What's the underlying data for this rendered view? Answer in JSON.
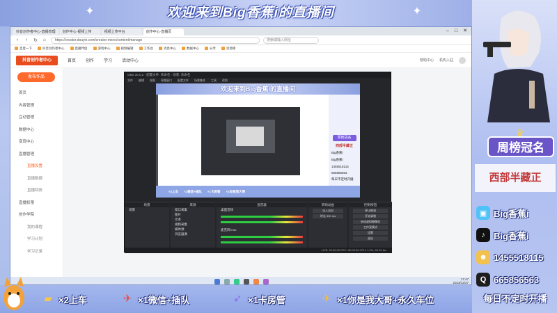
{
  "banner": {
    "title": "欢迎来到Big香蕉i的直播间"
  },
  "browser": {
    "tabs": [
      "抖音创作者中心-直播管理",
      "创作中心·视频上传",
      "视频上传平台",
      "创作中心·直播页"
    ],
    "url": "https://creator.douyin.com/creator-micro/content/manage",
    "search_placeholder": "搜索或输入网址",
    "bookmarks": [
      "百度一下",
      "抖音创作者中心",
      "直播伴侣",
      "游戏中心",
      "视频编辑",
      "工作台",
      "消息中心",
      "数据中心",
      "分享",
      "资源库"
    ]
  },
  "site": {
    "logo": "抖音创作者中心",
    "nav": [
      "首页",
      "创作",
      "学习",
      "活动中心"
    ],
    "header_right": [
      "帮助中心",
      "机构入驻"
    ],
    "upload_label": "发布作品",
    "sidebar": [
      {
        "label": "首页",
        "sub": false,
        "active": false
      },
      {
        "label": "内容管理",
        "sub": false,
        "active": false
      },
      {
        "label": "互动管理",
        "sub": false,
        "active": false
      },
      {
        "label": "数据中心",
        "sub": false,
        "active": false
      },
      {
        "label": "变现中心",
        "sub": false,
        "active": false
      },
      {
        "label": "直播管理",
        "sub": false,
        "active": false
      },
      {
        "label": "直播设置",
        "sub": true,
        "active": true
      },
      {
        "label": "直播数据",
        "sub": true,
        "active": false
      },
      {
        "label": "直播回放",
        "sub": true,
        "active": false
      },
      {
        "label": "直播权限",
        "sub": false,
        "active": false
      },
      {
        "label": "创作学院",
        "sub": false,
        "active": false
      },
      {
        "label": "我的课程",
        "sub": true,
        "active": false
      },
      {
        "label": "学习计划",
        "sub": true,
        "active": false
      },
      {
        "label": "学习记录",
        "sub": true,
        "active": false
      }
    ]
  },
  "obs": {
    "title": "OBS 30.0.2 - 配置文件: 未命名 - 场景: 未命名",
    "menu": [
      "文件",
      "编辑",
      "视图",
      "停靠窗口",
      "配置文件",
      "场景集合",
      "工具",
      "帮助"
    ],
    "preview_banner": "欢迎来到Big香蕉i的直播间",
    "preview_crown": "周榜冠名",
    "preview_name": "西部半藏正",
    "preview_rows": [
      "Big香蕉i",
      "Big香蕉i",
      "1455518115",
      "665856563",
      "每日不定时开播"
    ],
    "preview_ticker": [
      "×2上车",
      "×1微信+插队",
      "×1卡房管",
      "×1你是我大哥"
    ],
    "panels": {
      "scenes": {
        "title": "场景",
        "items": [
          "场景"
        ]
      },
      "sources": {
        "title": "来源",
        "items": [
          "窗口采集",
          "图片",
          "文本",
          "视频采集",
          "媒体源",
          "浏览器源"
        ]
      },
      "mixer": {
        "title": "混音器",
        "items": [
          "桌面音频",
          "麦克风/Aux"
        ]
      },
      "transitions": {
        "title": "转场动画",
        "items": [
          "淡入淡出",
          "时长 300 ms"
        ]
      },
      "controls": {
        "title": "控制按钮",
        "items": [
          "停止推流",
          "开始录制",
          "启动虚拟摄像机",
          "工作室模式",
          "设置",
          "退出"
        ]
      }
    },
    "status": "LIVE: 00:00:00   REC: 00:00:00   CPU: 1.9%, 60.00 fps"
  },
  "taskbar": {
    "time": "17:47",
    "date": "2023/12/27"
  },
  "right_panel": {
    "crown_label": "周榜冠名",
    "top_name": "西部半藏正",
    "contacts": [
      {
        "icon": "bilibili-icon",
        "text": "Big香蕉i",
        "color": "#4fc3f7"
      },
      {
        "icon": "douyin-icon",
        "text": "Big香蕉i",
        "color": "#111111"
      },
      {
        "icon": "game-icon",
        "text": "1455518115",
        "color": "#f2c14e"
      },
      {
        "icon": "qq-icon",
        "text": "665856563",
        "color": "#1e1e1e"
      }
    ],
    "schedule": "每日不定时开播"
  },
  "ticker": [
    {
      "icon": "gold-bar-icon",
      "text": "×2上车"
    },
    {
      "icon": "jet-icon",
      "text": "×1微信+插队"
    },
    {
      "icon": "rocket-icon",
      "text": "×1卡房管"
    },
    {
      "icon": "plane-icon",
      "text": "×1你是我大哥+永久车位"
    }
  ],
  "colors": {
    "accent": "#ff6a2c",
    "banner": "#8ea5e6",
    "crown": "#6a55c8",
    "name": "#c23b3b"
  }
}
